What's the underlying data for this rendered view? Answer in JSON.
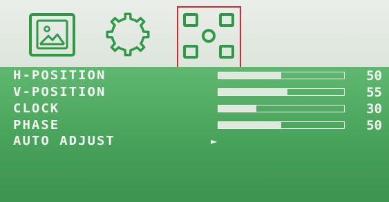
{
  "tabs": [
    {
      "icon": "picture-icon",
      "selected": false
    },
    {
      "icon": "gear-icon",
      "selected": false
    },
    {
      "icon": "position-adjust-icon",
      "selected": true
    }
  ],
  "rows": [
    {
      "label": "H-POSITION",
      "value": "50",
      "level": 0.5
    },
    {
      "label": "V-POSITION",
      "value": "55",
      "level": 0.55
    },
    {
      "label": "CLOCK",
      "value": "30",
      "level": 0.3
    },
    {
      "label": "PHASE",
      "value": "50",
      "level": 0.5
    },
    {
      "label": "AUTO ADJUST",
      "arrow": "►"
    }
  ],
  "colors": {
    "icon_green": "#2e9a45",
    "selected_frame": "#d8262a",
    "panel_green": "#43a85a"
  }
}
